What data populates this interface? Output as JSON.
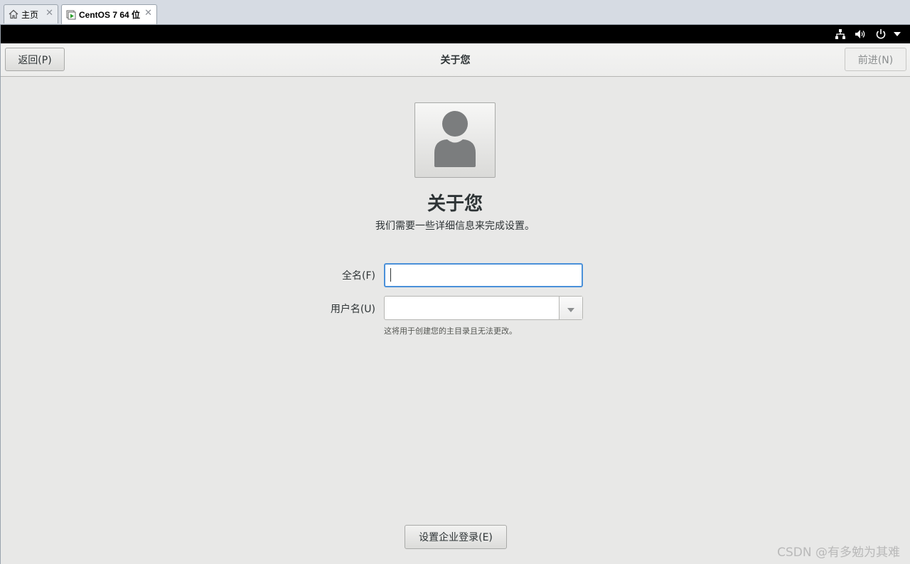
{
  "vm_tabs": [
    {
      "label": "主页",
      "icon": "home-icon",
      "active": false
    },
    {
      "label": "CentOS 7 64 位",
      "icon": "vm-running-icon",
      "active": true
    }
  ],
  "top_bar": {
    "indicators": [
      "network-icon",
      "volume-icon",
      "power-icon",
      "chevron-down-icon"
    ]
  },
  "header": {
    "back_label": "返回(P)",
    "title": "关于您",
    "next_label": "前进(N)",
    "next_enabled": false
  },
  "main": {
    "avatar_icon": "user-avatar-icon",
    "heading": "关于您",
    "subheading": "我们需要一些详细信息来完成设置。",
    "fullname_label": "全名(F)",
    "fullname_value": "",
    "username_label": "用户名(U)",
    "username_value": "",
    "username_hint": "这将用于创建您的主目录且无法更改。",
    "enterprise_label": "设置企业登录(E)"
  },
  "watermark": "CSDN @有多勉为其难",
  "colors": {
    "focus_border": "#4a90d9",
    "background": "#e8e8e7",
    "top_bar": "#000000"
  }
}
